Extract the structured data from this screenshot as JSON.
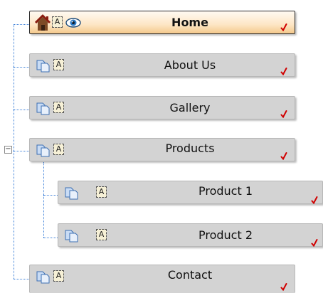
{
  "menu": {
    "items": [
      {
        "label": "Home",
        "selected": true
      },
      {
        "label": "About Us"
      },
      {
        "label": "Gallery"
      },
      {
        "label": "Products",
        "expanded": true,
        "children": [
          {
            "label": "Product 1"
          },
          {
            "label": "Product 2"
          }
        ]
      },
      {
        "label": "Contact"
      }
    ],
    "text_icon_glyph": "A",
    "expander_glyph": "−"
  },
  "colors": {
    "tree_line": "#3b7fd8",
    "node_bg": "#d3d3d3",
    "selected_bg": "#fde6c5",
    "check": "#d00000"
  },
  "icons": {
    "home_item": [
      "home-icon",
      "text-icon",
      "eye-icon"
    ],
    "page_item": [
      "pages-icon",
      "text-icon"
    ],
    "status": "checkmark-icon"
  }
}
